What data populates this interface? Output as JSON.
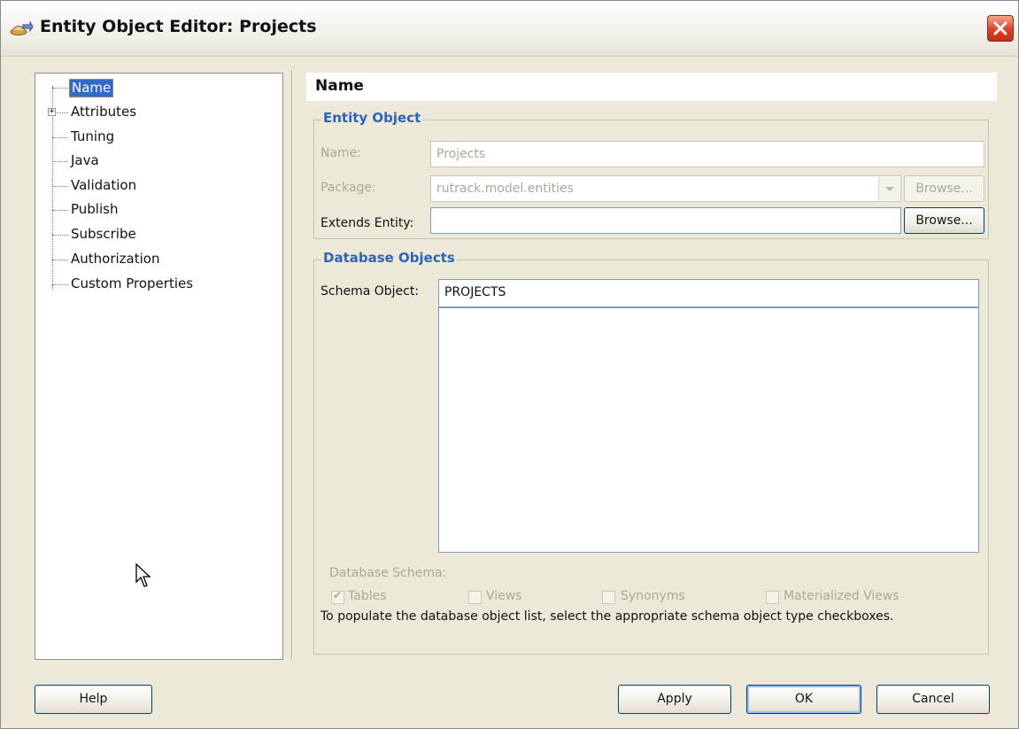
{
  "window": {
    "title": "Entity Object Editor: Projects"
  },
  "tree": {
    "items": [
      {
        "label": "Name",
        "selected": true
      },
      {
        "label": "Attributes",
        "expandable": true
      },
      {
        "label": "Tuning"
      },
      {
        "label": "Java"
      },
      {
        "label": "Validation"
      },
      {
        "label": "Publish"
      },
      {
        "label": "Subscribe"
      },
      {
        "label": "Authorization"
      },
      {
        "label": "Custom Properties"
      }
    ]
  },
  "page": {
    "title": "Name"
  },
  "entity_object": {
    "group_title": "Entity Object",
    "name_label": "Name:",
    "name_value": "Projects",
    "package_label": "Package:",
    "package_value": "rutrack.model.entities",
    "package_browse": "Browse...",
    "extends_label": "Extends Entity:",
    "extends_value": "",
    "extends_browse": "Browse..."
  },
  "database_objects": {
    "group_title": "Database Objects",
    "schema_object_label": "Schema Object:",
    "schema_object_value": "PROJECTS",
    "schema_label": "Database Schema:",
    "checkboxes": [
      {
        "label": "Tables",
        "checked": true
      },
      {
        "label": "Views",
        "checked": false
      },
      {
        "label": "Synonyms",
        "checked": false
      },
      {
        "label": "Materialized Views",
        "checked": false
      }
    ],
    "hint": "To populate the database object list, select the appropriate schema object type checkboxes."
  },
  "buttons": {
    "help": "Help",
    "apply": "Apply",
    "ok": "OK",
    "cancel": "Cancel"
  },
  "colors": {
    "accent": "#2e63b5",
    "selection": "#316ac5",
    "dialog_bg": "#ece9d8"
  }
}
